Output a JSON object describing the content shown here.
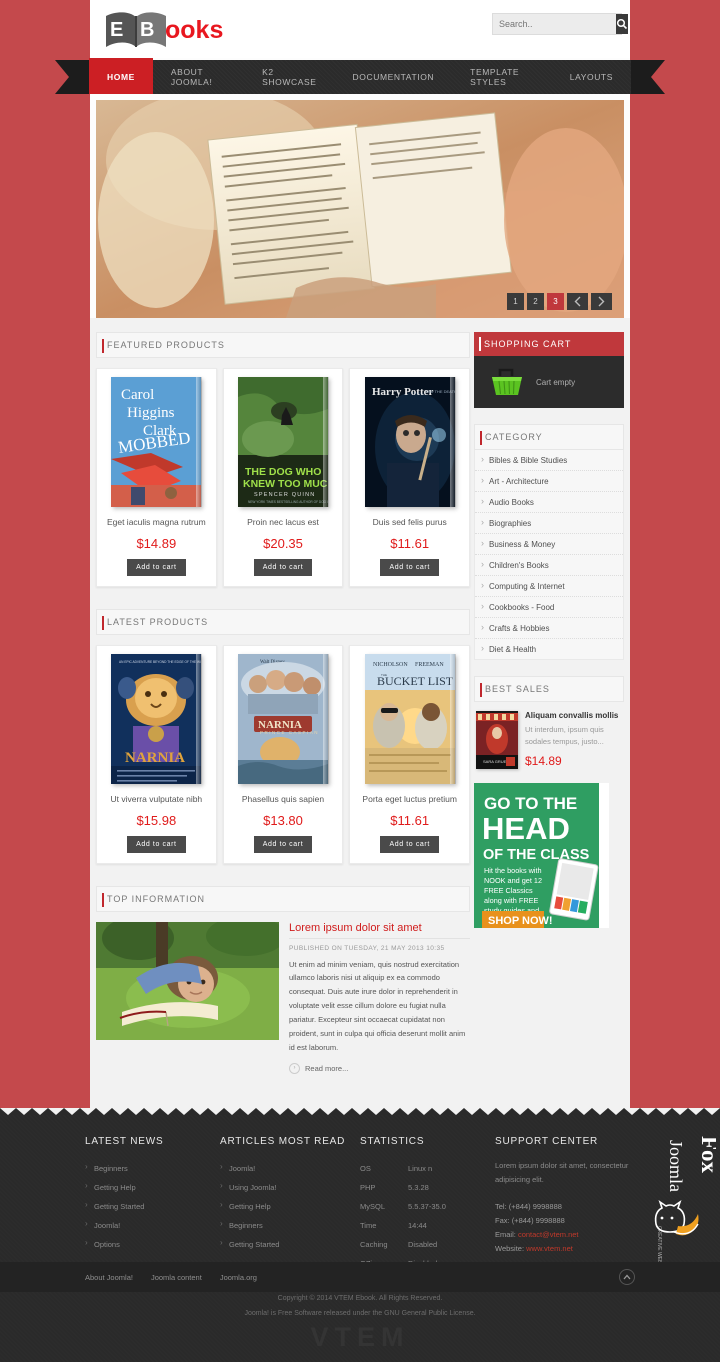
{
  "site": {
    "logo_dark": "EB",
    "logo_red": "ooks",
    "brand_red": "#cc1f24"
  },
  "search": {
    "placeholder": "Search..",
    "value": "",
    "icon": "search-icon"
  },
  "nav": {
    "items": [
      {
        "label": "Home",
        "active": true
      },
      {
        "label": "About Joomla!",
        "active": false
      },
      {
        "label": "K2 Showcase",
        "active": false
      },
      {
        "label": "Documentation",
        "active": false
      },
      {
        "label": "Template Styles",
        "active": false
      },
      {
        "label": "Layouts",
        "active": false
      }
    ]
  },
  "slider": {
    "dots": [
      "1",
      "2",
      "3"
    ],
    "active_dot": "3",
    "prev_icon": "chevron-left-icon",
    "next_icon": "chevron-right-icon"
  },
  "featured": {
    "heading": "Featured Products",
    "products": [
      {
        "title": "Eget iaculis magna rutrum",
        "price": "$14.89",
        "button": "Add to cart",
        "cover": "carol-higgins-clark-mobbed"
      },
      {
        "title": "Proin nec lacus est",
        "price": "$20.35",
        "button": "Add to cart",
        "cover": "the-dog-who-knew-too-much"
      },
      {
        "title": "Duis sed felis purus",
        "price": "$11.61",
        "button": "Add to cart",
        "cover": "harry-potter"
      }
    ]
  },
  "latest": {
    "heading": "Latest Products",
    "products": [
      {
        "title": "Ut viverra vulputate nibh",
        "price": "$15.98",
        "button": "Add to cart",
        "cover": "narnia-dawn-treader"
      },
      {
        "title": "Phasellus quis sapien",
        "price": "$13.80",
        "button": "Add to cart",
        "cover": "narnia-prince-caspian"
      },
      {
        "title": "Porta eget luctus pretium",
        "price": "$11.61",
        "button": "Add to cart",
        "cover": "the-bucket-list"
      }
    ]
  },
  "cart": {
    "heading": "Shopping Cart",
    "status": "Cart empty",
    "icon": "shopping-basket-icon"
  },
  "category": {
    "heading": "Category",
    "items": [
      "Bibles & Bible Studies",
      "Art - Architecture",
      "Audio Books",
      "Biographies",
      "Business & Money",
      "Children's Books",
      "Computing & Internet",
      "Cookbooks - Food",
      "Crafts & Hobbies",
      "Diet & Health"
    ]
  },
  "best_sales": {
    "heading": "Best Sales",
    "item": {
      "title": "Aliquam convallis mollis",
      "desc": "Ut interdum, ipsum quis sodales tempus, justo...",
      "price": "$14.89",
      "cover": "water-for-elephants"
    }
  },
  "banner": {
    "line1": "GO TO THE",
    "line2": "HEAD",
    "line3": "OF THE CLASS",
    "body": "Hit the books with NOOK and get 12 FREE Classics along with FREE study guides and apps",
    "cta": "SHOP NOW!",
    "bg": "#2f9e62",
    "cta_bg": "#e8911c"
  },
  "top_information": {
    "heading": "Top Information",
    "article": {
      "title": "Lorem ipsum dolor sit amet",
      "meta": "Published on Tuesday, 21 May 2013 10:35",
      "body": "Ut enim ad minim veniam, quis nostrud exercitation ullamco laboris nisi ut aliquip ex ea commodo consequat. Duis aute irure dolor in reprehenderit in voluptate velit esse cillum dolore eu fugiat nulla pariatur. Excepteur sint occaecat cupidatat non proident, sunt in culpa qui officia deserunt mollit anim id est laborum.",
      "read_more": "Read more...",
      "image": "girl-reading-book-on-grass"
    }
  },
  "footer": {
    "latest_news": {
      "title": "Latest News",
      "items": [
        "Beginners",
        "Getting Help",
        "Getting Started",
        "Joomla!",
        "Options"
      ]
    },
    "most_read": {
      "title": "Articles Most Read",
      "items": [
        "Joomla!",
        "Using Joomla!",
        "Getting Help",
        "Beginners",
        "Getting Started"
      ]
    },
    "statistics": {
      "title": "Statistics",
      "rows": [
        {
          "key": "OS",
          "value": "Linux n"
        },
        {
          "key": "PHP",
          "value": "5.3.28"
        },
        {
          "key": "MySQL",
          "value": "5.5.37-35.0"
        },
        {
          "key": "Time",
          "value": "14:44"
        },
        {
          "key": "Caching",
          "value": "Disabled"
        },
        {
          "key": "GZip",
          "value": "Disabled"
        }
      ]
    },
    "support": {
      "title": "Support Center",
      "text": "Lorem ipsum dolor sit amet, consectetur adipisicing elit.",
      "tel_label": "Tel:",
      "tel": "(+844) 9998888",
      "fax_label": "Fax:",
      "fax": "(+844) 9998888",
      "email_label": "Email:",
      "email": "contact@vtem.net",
      "website_label": "Website:",
      "website": "www.vtem.net"
    },
    "bottom_links": [
      "About Joomla!",
      "Joomla content",
      "Joomla.org"
    ],
    "to_top_icon": "chevron-up-icon",
    "copyright_line1": "Copyright © 2014 VTEM Ebook. All Rights Reserved.",
    "copyright_line2": "Joomla! is Free Software released under the GNU General Public License.",
    "watermark": "VTEM",
    "studio_logo": "JoomlaFox"
  }
}
